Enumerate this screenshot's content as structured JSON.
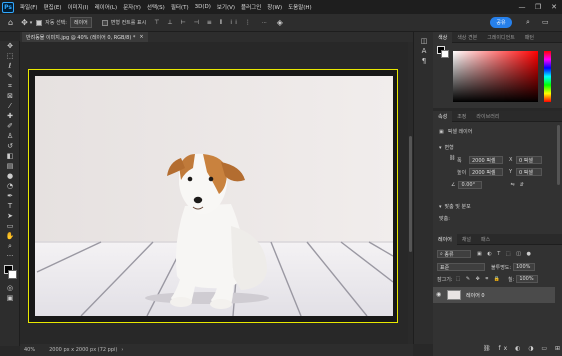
{
  "app": {
    "logo": "Ps"
  },
  "menu": [
    "파일(F)",
    "편집(E)",
    "이미지(I)",
    "레이어(L)",
    "문자(Y)",
    "선택(S)",
    "필터(T)",
    "3D(D)",
    "보기(V)",
    "플러그인",
    "창(W)",
    "도움말(H)"
  ],
  "options": {
    "auto_select_label": "자동 선택:",
    "auto_select_value": "레이어",
    "transform_label": "변형 컨트롤 표시",
    "more": "···",
    "share_label": "공유"
  },
  "document": {
    "tab_title": "반려동물 이미지.jpg @ 40% (레이어 0, RGB/8) *",
    "close": "×",
    "zoom": "40%",
    "info": "2000 px x 2000 px (72 ppi)"
  },
  "panels": {
    "color_tabs": [
      "색상",
      "색상 견본",
      "그레이디언트",
      "패턴"
    ],
    "props_tabs": [
      "속성",
      "조정",
      "라이브러리"
    ],
    "props_kind": "픽셀 레이어",
    "transform_title": "변형",
    "w_label": "폭",
    "w_value": "2000 픽셀",
    "x_label": "X",
    "x_value": "0 픽셀",
    "h_label": "높이",
    "h_value": "2000 픽셀",
    "y_label": "Y",
    "y_value": "0 픽셀",
    "angle_value": "0.00°",
    "align_title": "맞춤 및 분포",
    "align_sub": "맞춤:",
    "layers_tabs": [
      "레이어",
      "채널",
      "패스"
    ],
    "filter_kind": "종류",
    "blend_mode": "표준",
    "opacity_label": "불투명도:",
    "opacity_value": "100%",
    "lock_label": "잠그기:",
    "fill_label": "칠:",
    "fill_value": "100%",
    "layer_name": "레이어 0"
  },
  "colors": {
    "accent": "#2680eb",
    "artboard_border": "#e8e800",
    "panel_bg": "#323232"
  }
}
